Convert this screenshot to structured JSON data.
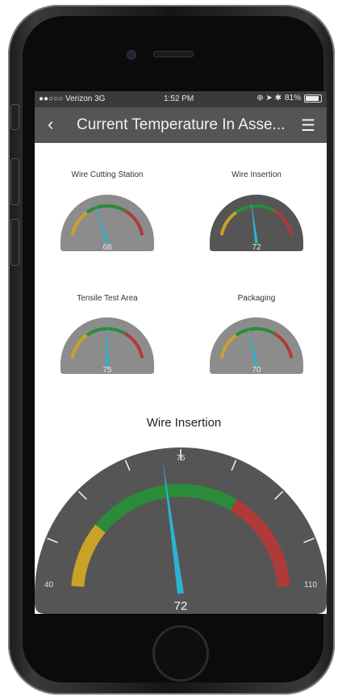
{
  "status_bar": {
    "carrier": "●●○○○ Verizon  3G",
    "time": "1:52 PM",
    "battery": "81%"
  },
  "nav": {
    "title": "Current Temperature In Asse...",
    "back_icon": "chevron-left-icon",
    "menu_icon": "hamburger-menu-icon"
  },
  "gauges": [
    {
      "name": "Wire Cutting Station",
      "value": 68,
      "dial": "#8c8c8c"
    },
    {
      "name": "Wire Insertion",
      "value": 72,
      "dial": "#555555"
    },
    {
      "name": "Tensile Test Area",
      "value": 75,
      "dial": "#8c8c8c"
    },
    {
      "name": "Packaging",
      "value": 70,
      "dial": "#8c8c8c"
    }
  ],
  "big_gauge": {
    "name": "Wire Insertion",
    "value": 72,
    "min": 40,
    "max": 110,
    "mid_label": 75
  },
  "colors": {
    "yellow": "#c9a227",
    "green": "#2a8c3a",
    "red": "#b03a3a",
    "needle": "#2bb3d1"
  }
}
